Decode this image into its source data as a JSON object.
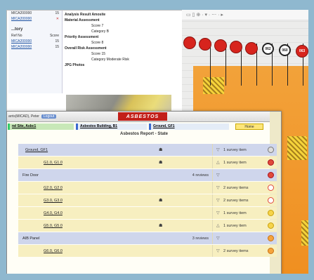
{
  "survey": {
    "table_caption": "...tory",
    "col_ref": "Ref No",
    "col_score": "Score",
    "top_ref": "MICA200000",
    "top_score": "15",
    "row1_ref": "MICA200000",
    "row1_score": "15",
    "row2_ref": "MICA200000",
    "row2_score": "15",
    "delete_glyph": "✕",
    "lines": [
      "Analysis Result   Amosite",
      "Material Assessment",
      "Score  7",
      "Category  B",
      "Priority Assessment",
      "Score  8",
      "Overall Risk Assessment",
      "Score  15",
      "Category  Moderate Risk",
      "JPG Photos"
    ]
  },
  "plan": {
    "toolbar": "▭ ▯ ⊕ · ▾ · ⋯ · ▸",
    "signs": [
      "",
      "",
      "",
      "",
      "",
      "062",
      "060",
      "063"
    ]
  },
  "report": {
    "user": "arris(MICAD), Peter",
    "logout": "Logout",
    "brand": "ASBESTOS",
    "user_icon": "☻",
    "crumbs": [
      "nd Site, Asbc1",
      "Asbestos Building, B1",
      "Ground, GF1"
    ],
    "home": "Home",
    "title": "Asbestos Report - State",
    "rows": [
      {
        "name": "Ground, GF1",
        "kind": "group",
        "cam": "☗",
        "reviews": "",
        "arrow": "▽",
        "count": "1 survey item",
        "status": "grey"
      },
      {
        "name": "G1.0, G1.0",
        "kind": "item",
        "cam": "☗",
        "reviews": "",
        "arrow": "△",
        "count": "1 survey item",
        "status": "red"
      },
      {
        "name": "Fire Door",
        "kind": "group2",
        "cam": "",
        "reviews": "4 reviews",
        "arrow": "▽",
        "count": "",
        "status": "red"
      },
      {
        "name": "G2.0, G2.0",
        "kind": "item",
        "cam": "",
        "reviews": "",
        "arrow": "▽",
        "count": "2 survey items",
        "status": "ring"
      },
      {
        "name": "G3.0, G3.0",
        "kind": "item",
        "cam": "☗",
        "reviews": "",
        "arrow": "▽",
        "count": "2 survey items",
        "status": "ring"
      },
      {
        "name": "G4.0, G4.0",
        "kind": "item",
        "cam": "",
        "reviews": "",
        "arrow": "▽",
        "count": "1 survey item",
        "status": "yellow"
      },
      {
        "name": "G5.0, G5.0",
        "kind": "item",
        "cam": "☗",
        "reviews": "",
        "arrow": "△",
        "count": "1 survey item",
        "status": "yellow"
      },
      {
        "name": "AIB Panel",
        "kind": "group2",
        "cam": "",
        "reviews": "3 reviews",
        "arrow": "▽",
        "count": "",
        "status": "orange"
      },
      {
        "name": "G6.0, G6.0",
        "kind": "item",
        "cam": "",
        "reviews": "",
        "arrow": "▽",
        "count": "2 survey items",
        "status": "orange"
      }
    ]
  },
  "colors": {
    "accent": "#c21f19",
    "group_row": "#cfd6ec",
    "item_row": "#f7efc0",
    "plan_orange": "#f08f20"
  }
}
